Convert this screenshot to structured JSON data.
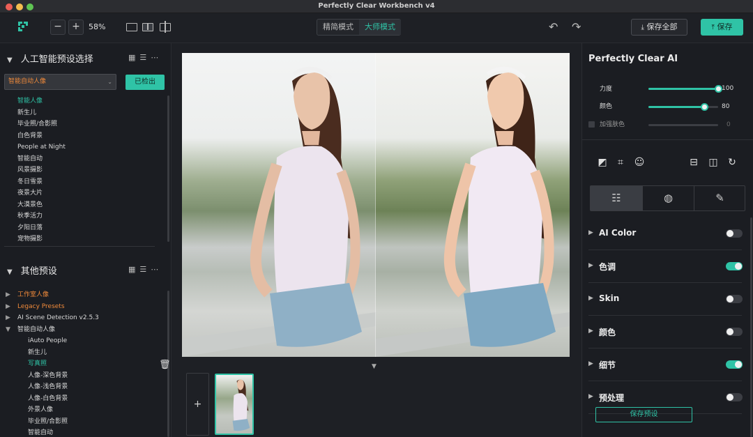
{
  "window": {
    "title": "Perfectly Clear Workbench v4"
  },
  "toolbar": {
    "zoom_out": "−",
    "zoom_in": "+",
    "zoom_level": "58%",
    "modes": [
      {
        "label": "精简模式",
        "active": false
      },
      {
        "label": "大师模式",
        "active": true
      }
    ],
    "undo_icon": "undo-icon",
    "redo_icon": "redo-icon",
    "save_all_label": "保存全部",
    "save_label": "保存"
  },
  "left": {
    "ai_section": {
      "title": "人工智能预设选择",
      "selected_preset": "智能自动人像",
      "detected_label": "已检出",
      "presets": [
        {
          "label": "智能人像",
          "active": true
        },
        {
          "label": "新生儿"
        },
        {
          "label": "毕业照/合影照"
        },
        {
          "label": "白色背景"
        },
        {
          "label": "People at Night"
        },
        {
          "label": "智能自动"
        },
        {
          "label": "风景摄影"
        },
        {
          "label": "冬日雪景"
        },
        {
          "label": "夜景大片"
        },
        {
          "label": "大漠景色"
        },
        {
          "label": "秋季活力"
        },
        {
          "label": "夕阳日落"
        },
        {
          "label": "宠物摄影"
        }
      ]
    },
    "other_section": {
      "title": "其他预设",
      "tree": [
        {
          "label": "工作室人像",
          "tri": "▶",
          "style": "orange",
          "level": 1
        },
        {
          "label": "Legacy Presets",
          "tri": "▶",
          "style": "orange",
          "level": 1
        },
        {
          "label": "AI Scene Detection v2.5.3",
          "tri": "▶",
          "style": "normal",
          "level": 1
        },
        {
          "label": "智能自动人像",
          "tri": "▼",
          "style": "normal",
          "level": 1
        },
        {
          "label": "iAuto People",
          "level": 2
        },
        {
          "label": "新生儿",
          "level": 2
        },
        {
          "label": "写真照",
          "level": 2,
          "style": "green"
        },
        {
          "label": "人像-深色背景",
          "level": 2
        },
        {
          "label": "人像-浅色背景",
          "level": 2
        },
        {
          "label": "人像-白色背景",
          "level": 2
        },
        {
          "label": "外景人像",
          "level": 2
        },
        {
          "label": "毕业照/合影照",
          "level": 2
        },
        {
          "label": "智能自动",
          "level": 2
        }
      ]
    }
  },
  "right": {
    "title": "Perfectly Clear AI",
    "sliders": [
      {
        "label": "力度",
        "value": 100,
        "max": 100,
        "enabled": true
      },
      {
        "label": "颜色",
        "value": 80,
        "max": 100,
        "enabled": true
      },
      {
        "label": "加强肤色",
        "value": 0,
        "max": 100,
        "enabled": false
      }
    ],
    "sections": [
      {
        "label": "AI Color",
        "on": false
      },
      {
        "label": "色调",
        "on": true
      },
      {
        "label": "Skin",
        "on": false
      },
      {
        "label": "颜色",
        "on": false
      },
      {
        "label": "细节",
        "on": true
      },
      {
        "label": "预处理",
        "on": false
      }
    ],
    "save_preset_label": "保存预设"
  },
  "colors": {
    "accent": "#2fc3a6",
    "highlight": "#f08a3a",
    "panel": "#1b1d22"
  }
}
